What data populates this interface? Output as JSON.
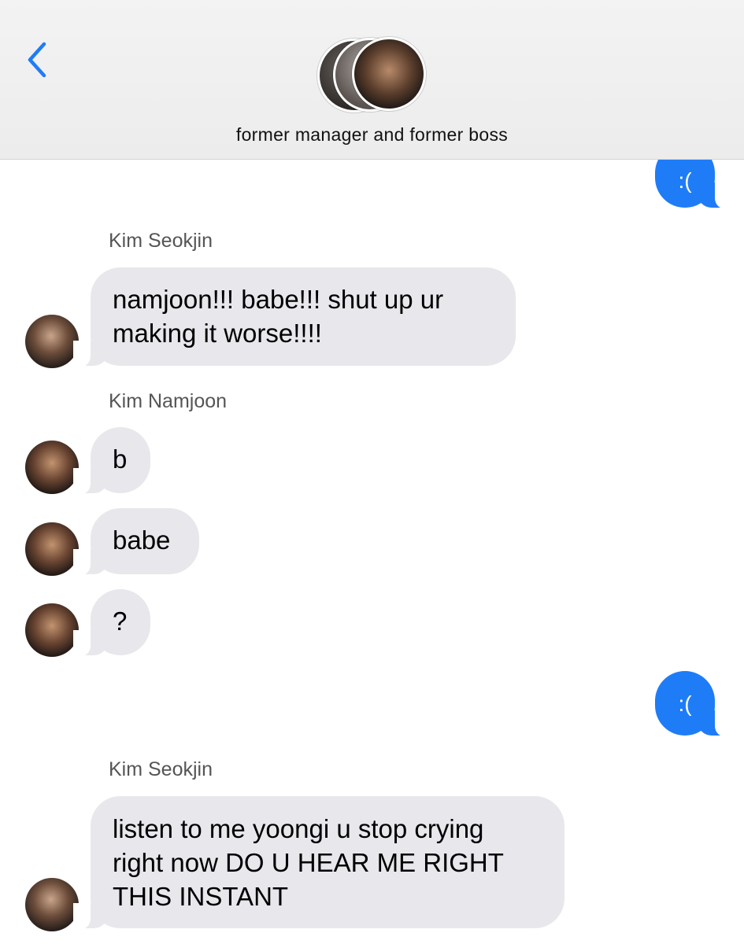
{
  "header": {
    "back_icon": "chevron-left-icon",
    "group_title": "former manager and former boss",
    "accent_color": "#1f7cf7"
  },
  "messages": [
    {
      "type": "outgoing",
      "text": ":("
    },
    {
      "type": "incoming",
      "sender": "Kim Seokjin",
      "lines": [
        "namjoon!!! babe!!! shut up ur",
        "making it worse!!!!"
      ]
    },
    {
      "type": "incoming",
      "sender": "Kim Namjoon",
      "text": "b"
    },
    {
      "type": "incoming",
      "text": "babe"
    },
    {
      "type": "incoming",
      "text": "?"
    },
    {
      "type": "outgoing",
      "text": ":("
    },
    {
      "type": "incoming",
      "sender": "Kim Seokjin",
      "lines": [
        "listen to me yoongi u stop crying",
        "right now DO U HEAR ME RIGHT",
        "THIS INSTANT"
      ]
    }
  ],
  "colors": {
    "incoming_bubble": "#e7e7ec",
    "outgoing_bubble": "#1f7cf7"
  }
}
